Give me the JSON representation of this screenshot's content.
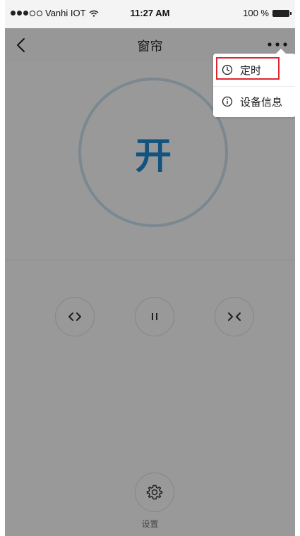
{
  "status_bar": {
    "carrier": "Vanhi IOT",
    "time": "11:27 AM",
    "battery_percent": "100 %"
  },
  "nav": {
    "title": "窗帘"
  },
  "power": {
    "label": "开",
    "accent_color": "#1e86cf"
  },
  "controls": {
    "open_icon": "curtain-open-icon",
    "pause_icon": "pause-icon",
    "close_icon": "curtain-close-icon"
  },
  "settings": {
    "label": "设置",
    "icon": "gear-icon"
  },
  "menu": {
    "items": [
      {
        "label": "定时",
        "icon": "clock-icon",
        "highlighted": true,
        "highlight_color": "#e0262c"
      },
      {
        "label": "设备信息",
        "icon": "info-icon"
      }
    ]
  }
}
